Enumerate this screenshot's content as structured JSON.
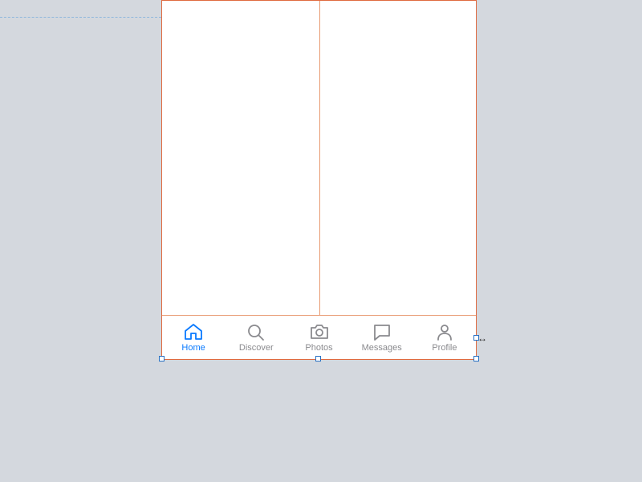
{
  "canvas": {
    "artboard_selected": true
  },
  "tabbar": {
    "items": [
      {
        "label": "Home",
        "icon": "home-icon",
        "active": true
      },
      {
        "label": "Discover",
        "icon": "search-icon",
        "active": false
      },
      {
        "label": "Photos",
        "icon": "camera-icon",
        "active": false
      },
      {
        "label": "Messages",
        "icon": "message-icon",
        "active": false
      },
      {
        "label": "Profile",
        "icon": "person-icon",
        "active": false
      }
    ]
  }
}
